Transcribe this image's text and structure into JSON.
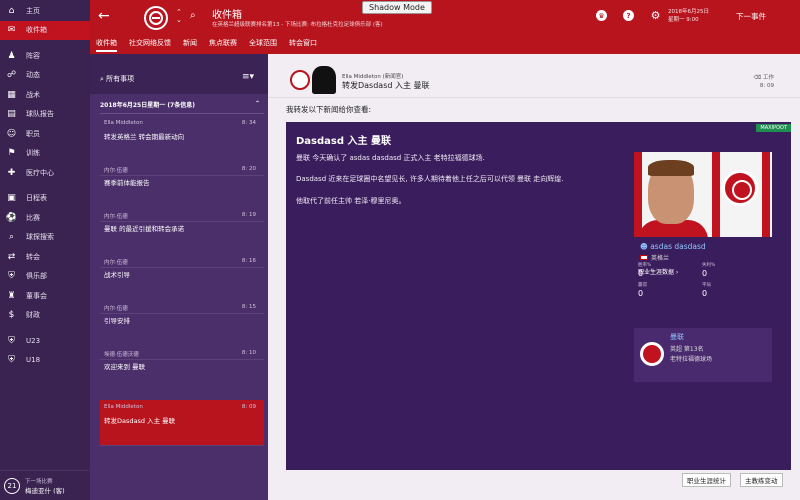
{
  "sidebar": {
    "items": [
      {
        "label": "主页",
        "icon": "home-icon",
        "glyph": "⌂"
      },
      {
        "label": "收件箱",
        "icon": "inbox-icon",
        "glyph": "✉",
        "active": true
      },
      {
        "label": "阵容",
        "icon": "squad-icon",
        "glyph": "♟"
      },
      {
        "label": "动态",
        "icon": "dynamics-icon",
        "glyph": "☍"
      },
      {
        "label": "战术",
        "icon": "tactics-icon",
        "glyph": "▦"
      },
      {
        "label": "球队报告",
        "icon": "report-icon",
        "glyph": "▤"
      },
      {
        "label": "职员",
        "icon": "staff-icon",
        "glyph": "☺"
      },
      {
        "label": "训练",
        "icon": "training-icon",
        "glyph": "⚑"
      },
      {
        "label": "医疗中心",
        "icon": "medical-icon",
        "glyph": "✚"
      },
      {
        "label": "日程表",
        "icon": "calendar-icon",
        "glyph": "▣"
      },
      {
        "label": "比赛",
        "icon": "match-icon",
        "glyph": "⚽"
      },
      {
        "label": "球探搜索",
        "icon": "scouting-icon",
        "glyph": "⌕"
      },
      {
        "label": "转会",
        "icon": "transfer-icon",
        "glyph": "⇄"
      },
      {
        "label": "俱乐部",
        "icon": "club-icon",
        "glyph": "⛨"
      },
      {
        "label": "董事会",
        "icon": "board-icon",
        "glyph": "♜"
      },
      {
        "label": "财政",
        "icon": "finance-icon",
        "glyph": "$"
      },
      {
        "label": "U23",
        "icon": "u23-icon",
        "glyph": "⛨"
      },
      {
        "label": "U18",
        "icon": "u18-icon",
        "glyph": "⛨"
      }
    ],
    "footer": {
      "badge": "21",
      "next_match_label": "下一场比赛",
      "next_match_team": "梅迪亚什 (客)"
    }
  },
  "header": {
    "title": "收件箱",
    "subtitle": "在英格兰超级联赛排名第13 - 下场比赛: 布拉格杜克拉足球俱乐部 (客)",
    "shadow_mode": "Shadow Mode",
    "date": "2018年6月25日",
    "day_time": "星期一 9:00",
    "continue_label": "下一事件",
    "tabs": [
      "收件箱",
      "社交网络反馈",
      "新闻",
      "焦点联赛",
      "全球范围",
      "转会窗口"
    ]
  },
  "list": {
    "filter_label": "所有事项",
    "date_group": "2018年6月25日星期一 (7条信息)",
    "messages": [
      {
        "from": "Ella Middleton",
        "subject": "转发英格兰 转会期最新动向",
        "time": "8: 34"
      },
      {
        "from": "内尔·伍德",
        "subject": "赛季前体能报告",
        "time": "8: 20"
      },
      {
        "from": "内尔·伍德",
        "subject": "曼联 的最近引援和转会承诺",
        "time": "8: 19"
      },
      {
        "from": "内尔·伍德",
        "subject": "战术引导",
        "time": "8: 16"
      },
      {
        "from": "内尔·伍德",
        "subject": "引导安排",
        "time": "8: 15"
      },
      {
        "from": "埃德·伍德沃德",
        "subject": "欢迎来到 曼联",
        "time": "8: 10"
      },
      {
        "from": "Ella Middleton",
        "subject": "转发Dasdasd 入主 曼联",
        "time": "8: 09"
      }
    ]
  },
  "reader": {
    "sender": "Ella Middleton (新闻官)",
    "subject": "转发Dasdasd 入主 曼联",
    "tag": "工作",
    "time": "8: 09",
    "forward_line": "我转发以下新闻给你查看:",
    "article": {
      "source": "MAXIPOOT",
      "title": "Dasdasd 入主 曼联",
      "para1": "曼联 今天确认了 asdas dasdasd 正式入主 老特拉福德球场.",
      "para2": "Dasdasd 近来在足球圈中名望见长, 许多人期待着他上任之后可以代领 曼联 走向辉煌.",
      "para3": "他取代了前任主帅 若泽·穆里尼奥。"
    },
    "player": {
      "name": "asdas dasdasd",
      "nation": "英格兰",
      "career_label": "职业生涯数据 ›",
      "stats": [
        {
          "label": "胜率%",
          "value": "0"
        },
        {
          "label": "失利%",
          "value": "0"
        },
        {
          "label": "赢得",
          "value": "0"
        },
        {
          "label": "平局",
          "value": "0"
        },
        {
          "label": "输球",
          "value": "0"
        }
      ]
    },
    "club": {
      "name": "曼联",
      "rank": "英超 第13名",
      "stadium": "老特拉福德球场"
    },
    "buttons": {
      "career_stats": "职业生涯统计",
      "coach_move": "主教练变动"
    }
  }
}
